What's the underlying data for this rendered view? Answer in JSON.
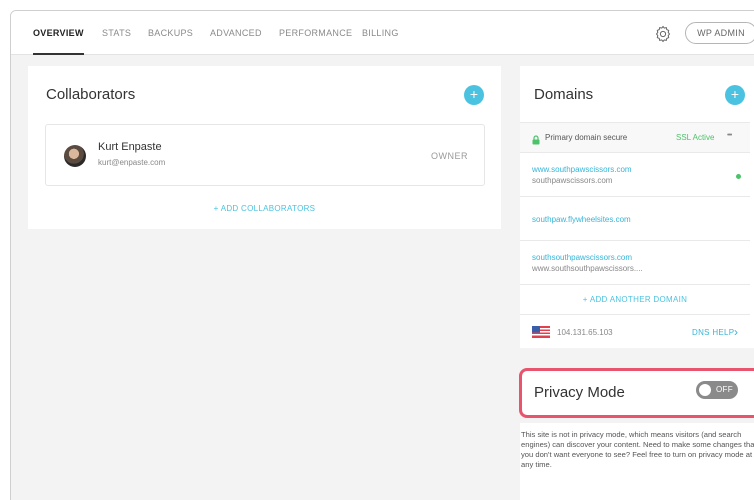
{
  "tabs": [
    {
      "label": "OVERVIEW",
      "active": true
    },
    {
      "label": "STATS"
    },
    {
      "label": "BACKUPS"
    },
    {
      "label": "ADVANCED"
    },
    {
      "label": "PERFORMANCE"
    },
    {
      "label": "BILLING"
    }
  ],
  "header": {
    "wp_admin_label": "WP ADMIN"
  },
  "collaborators": {
    "title": "Collaborators",
    "add_icon": "+",
    "items": [
      {
        "name": "Kurt Enpaste",
        "email": "kurt@enpaste.com",
        "role": "OWNER"
      }
    ],
    "add_label": "+  ADD COLLABORATORS"
  },
  "domains": {
    "title": "Domains",
    "add_icon": "+",
    "primary_secure": "Primary domain secure",
    "ssl_status": "SSL Active",
    "more_icon": "•••",
    "entries": [
      {
        "domain": "www.southpawscissors.com",
        "subtitle": "southpawscissors.com"
      },
      {
        "domain": "southpaw.flywheelsites.com",
        "subtitle": ""
      },
      {
        "domain": "southsouthpawscissors.com",
        "subtitle": "www.southsouthpawscissors...."
      }
    ],
    "add_label": "+  ADD ANOTHER DOMAIN",
    "ip_address": "104.131.65.103",
    "dns_help": "DNS HELP",
    "dns_chevron": "›"
  },
  "privacy": {
    "title": "Privacy Mode",
    "toggle_label": "OFF",
    "description": "This site is not in privacy mode, which means visitors (and search engines) can discover your content. Need to make some changes that you don't want everyone to see? Feel free to turn on privacy mode at any time."
  },
  "colors": {
    "accent": "#4bc3e0",
    "link": "#36b5d8",
    "ssl_green": "#4cc36a",
    "highlight": "#e8546d"
  }
}
